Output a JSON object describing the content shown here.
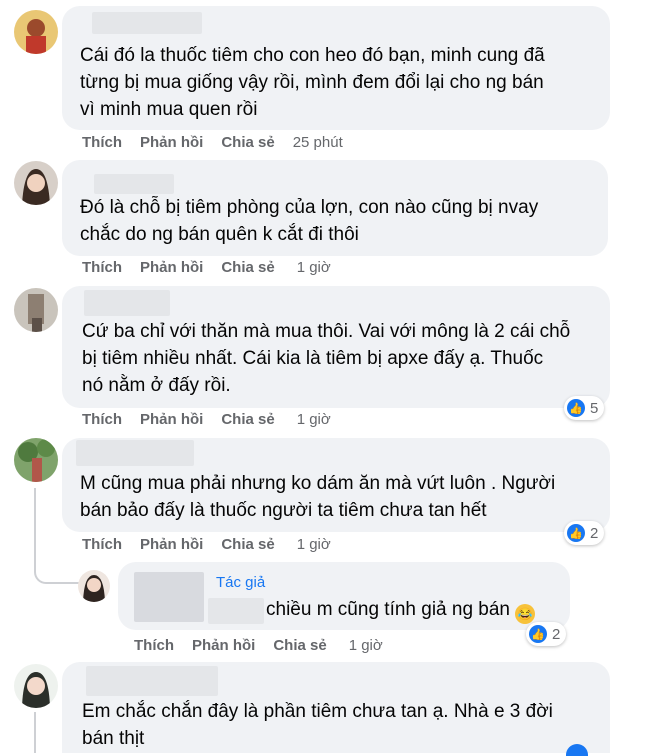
{
  "actions": {
    "like": "Thích",
    "reply": "Phản hồi",
    "share": "Chia sẻ"
  },
  "comments": [
    {
      "lines": [
        "Cái đó la thuốc tiêm cho con heo đó bạn, minh cung đã",
        "từng bị mua giống vậy rồi, mình đem đổi lại cho ng bán",
        "vì minh mua quen rồi"
      ],
      "time": "25 phút"
    },
    {
      "lines": [
        "Đó là chỗ bị tiêm phòng của lợn, con nào cũng bị nvay",
        "chắc do ng bán quên k cắt đi thôi"
      ],
      "time": "1 giờ"
    },
    {
      "lines": [
        "Cứ ba chỉ với thăn mà mua thôi. Vai với mông là 2 cái chỗ",
        "bị tiêm nhiều nhất. Cái kia là tiêm bị apxe đấy ạ. Thuốc",
        "nó nằm ở đấy rồi."
      ],
      "time": "1 giờ",
      "reactions": "5"
    },
    {
      "lines": [
        "M cũng mua phải nhưng ko dám ăn mà vứt luôn . Người",
        "bán bảo đấy là thuốc người ta tiêm chưa tan hết"
      ],
      "time": "1 giờ",
      "reactions": "2"
    },
    {
      "author_tag": "Tác giả",
      "text": "chiều m cũng tính giả ng bán",
      "emoji": "laughing-crying-emoji",
      "time": "1 giờ",
      "reactions": "2"
    },
    {
      "lines": [
        "Em chắc chắn đây là phần tiêm chưa tan ạ. Nhà e 3 đời",
        "bán thịt"
      ]
    }
  ],
  "colors": {
    "bubble": "#f0f2f5",
    "link": "#1877f2",
    "meta": "#65676b",
    "text": "#050505"
  }
}
